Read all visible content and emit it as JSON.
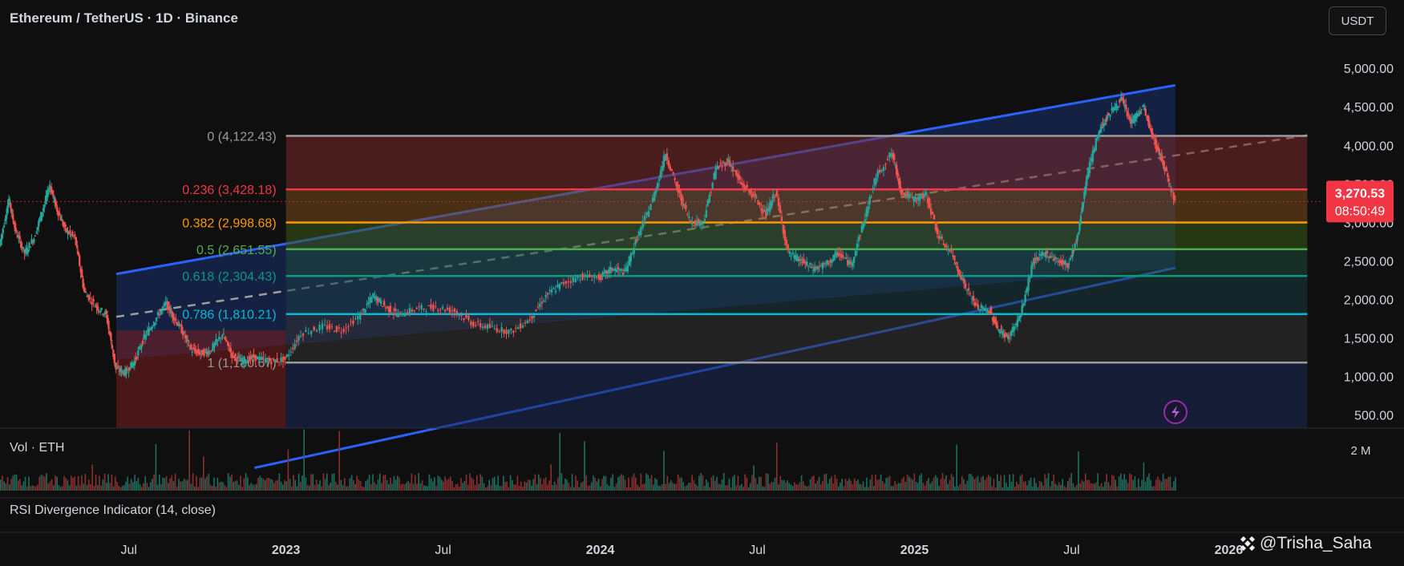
{
  "header": {
    "title": "Ethereum / TetherUS · 1D · Binance"
  },
  "currency_button": {
    "label": "USDT"
  },
  "price_badge": {
    "price": "3,270.53",
    "countdown": "08:50:49",
    "price_value": 3270.53
  },
  "volume_pane": {
    "label": "Vol · ETH",
    "axis_label": "2 M"
  },
  "rsi_pane": {
    "label": "RSI Divergence Indicator (14, close)"
  },
  "watermark": {
    "text": "@Trisha_Saha"
  },
  "colors": {
    "background": "#0f0f0f",
    "up": "#26a69a",
    "down": "#ef5350",
    "channel": "#2962ff",
    "price_badge": "#f23645"
  },
  "chart_data": {
    "type": "candlestick",
    "title": "Ethereum / TetherUS · 1D · Binance",
    "y_axis": {
      "ticks": [
        "5,000.00",
        "4,500.00",
        "4,000.00",
        "3,500.00",
        "3,000.00",
        "2,500.00",
        "2,000.00",
        "1,500.00",
        "1,000.00",
        "500.00"
      ],
      "ylim": [
        330,
        5470
      ]
    },
    "x_axis": {
      "ticks": [
        {
          "label": "Jul",
          "x": 2022.5
        },
        {
          "label": "2023",
          "x": 2023.0
        },
        {
          "label": "Jul",
          "x": 2023.5
        },
        {
          "label": "2024",
          "x": 2024.0
        },
        {
          "label": "Jul",
          "x": 2024.5
        },
        {
          "label": "2025",
          "x": 2025.0
        },
        {
          "label": "Jul",
          "x": 2025.5
        },
        {
          "label": "2026",
          "x": 2026.0
        }
      ],
      "xlim": [
        2022.09,
        2026.3
      ]
    },
    "price_path": [
      [
        2022.09,
        2700
      ],
      [
        2022.12,
        3300
      ],
      [
        2022.14,
        2900
      ],
      [
        2022.17,
        2600
      ],
      [
        2022.2,
        2800
      ],
      [
        2022.23,
        3200
      ],
      [
        2022.25,
        3480
      ],
      [
        2022.27,
        3200
      ],
      [
        2022.3,
        2900
      ],
      [
        2022.33,
        2800
      ],
      [
        2022.36,
        2100
      ],
      [
        2022.4,
        1900
      ],
      [
        2022.43,
        1800
      ],
      [
        2022.46,
        1100
      ],
      [
        2022.49,
        1050
      ],
      [
        2022.52,
        1200
      ],
      [
        2022.55,
        1500
      ],
      [
        2022.58,
        1700
      ],
      [
        2022.62,
        1950
      ],
      [
        2022.64,
        1800
      ],
      [
        2022.67,
        1600
      ],
      [
        2022.7,
        1350
      ],
      [
        2022.73,
        1300
      ],
      [
        2022.76,
        1330
      ],
      [
        2022.8,
        1550
      ],
      [
        2022.83,
        1280
      ],
      [
        2022.86,
        1200
      ],
      [
        2022.9,
        1250
      ],
      [
        2022.95,
        1200
      ],
      [
        2023.0,
        1220
      ],
      [
        2023.05,
        1560
      ],
      [
        2023.12,
        1650
      ],
      [
        2023.18,
        1600
      ],
      [
        2023.24,
        1800
      ],
      [
        2023.28,
        2050
      ],
      [
        2023.32,
        1900
      ],
      [
        2023.36,
        1800
      ],
      [
        2023.42,
        1880
      ],
      [
        2023.48,
        1900
      ],
      [
        2023.54,
        1850
      ],
      [
        2023.6,
        1680
      ],
      [
        2023.66,
        1630
      ],
      [
        2023.72,
        1580
      ],
      [
        2023.78,
        1750
      ],
      [
        2023.83,
        2050
      ],
      [
        2023.88,
        2200
      ],
      [
        2023.94,
        2300
      ],
      [
        2024.0,
        2280
      ],
      [
        2024.04,
        2400
      ],
      [
        2024.08,
        2350
      ],
      [
        2024.12,
        2800
      ],
      [
        2024.17,
        3300
      ],
      [
        2024.21,
        3900
      ],
      [
        2024.25,
        3400
      ],
      [
        2024.29,
        3000
      ],
      [
        2024.33,
        3000
      ],
      [
        2024.37,
        3700
      ],
      [
        2024.41,
        3800
      ],
      [
        2024.45,
        3500
      ],
      [
        2024.49,
        3350
      ],
      [
        2024.53,
        3100
      ],
      [
        2024.56,
        3400
      ],
      [
        2024.6,
        2600
      ],
      [
        2024.64,
        2500
      ],
      [
        2024.68,
        2400
      ],
      [
        2024.72,
        2450
      ],
      [
        2024.76,
        2600
      ],
      [
        2024.8,
        2450
      ],
      [
        2024.84,
        3000
      ],
      [
        2024.88,
        3600
      ],
      [
        2024.93,
        3900
      ],
      [
        2024.96,
        3400
      ],
      [
        2025.0,
        3300
      ],
      [
        2025.04,
        3350
      ],
      [
        2025.08,
        2800
      ],
      [
        2025.12,
        2600
      ],
      [
        2025.16,
        2200
      ],
      [
        2025.2,
        1900
      ],
      [
        2025.24,
        1850
      ],
      [
        2025.27,
        1600
      ],
      [
        2025.3,
        1500
      ],
      [
        2025.34,
        1800
      ],
      [
        2025.38,
        2500
      ],
      [
        2025.42,
        2600
      ],
      [
        2025.46,
        2500
      ],
      [
        2025.49,
        2450
      ],
      [
        2025.52,
        2800
      ],
      [
        2025.55,
        3600
      ],
      [
        2025.59,
        4200
      ],
      [
        2025.62,
        4400
      ],
      [
        2025.66,
        4600
      ],
      [
        2025.69,
        4300
      ],
      [
        2025.73,
        4500
      ],
      [
        2025.76,
        4100
      ],
      [
        2025.78,
        3900
      ],
      [
        2025.8,
        3700
      ],
      [
        2025.83,
        3270
      ]
    ],
    "fib_retracement": [
      {
        "level": "0",
        "label": "0 (4,122.43)",
        "price": 4122.43,
        "color": "#9a9a9a"
      },
      {
        "level": "0.236",
        "label": "0.236 (3,428.18)",
        "price": 3428.18,
        "color": "#f23645"
      },
      {
        "level": "0.382",
        "label": "0.382 (2,998.68)",
        "price": 2998.68,
        "color": "#ff9800"
      },
      {
        "level": "0.5",
        "label": "0.5 (2,651.55)",
        "price": 2651.55,
        "color": "#4caf50"
      },
      {
        "level": "0.618",
        "label": "0.618 (2,304.43)",
        "price": 2304.43,
        "color": "#089981"
      },
      {
        "level": "0.786",
        "label": "0.786 (1,810.21)",
        "price": 1810.21,
        "color": "#00bcd4"
      },
      {
        "level": "1",
        "label": "1 (1,180.67)",
        "price": 1180.67,
        "color": "#9a9a9a"
      }
    ],
    "fib_zones": [
      {
        "from": 4122.43,
        "to": 3428.18,
        "color": "#7a2a2a"
      },
      {
        "from": 3428.18,
        "to": 2998.68,
        "color": "#7a4a1a"
      },
      {
        "from": 2998.68,
        "to": 2651.55,
        "color": "#3a5a1a"
      },
      {
        "from": 2651.55,
        "to": 2304.43,
        "color": "#1d4a3a"
      },
      {
        "from": 2304.43,
        "to": 1810.21,
        "color": "#1b3a44"
      },
      {
        "from": 1810.21,
        "to": 1180.67,
        "color": "#333333"
      }
    ],
    "fib_extent": [
      2023.0,
      2026.25
    ],
    "parallel_channel": {
      "start_date": 2022.46,
      "end_date": 2025.83,
      "upper": [
        2330,
        4780
      ],
      "lower": [
        1220,
        2410
      ],
      "extended_mid_end": [
        2026.25,
        4130
      ]
    },
    "volume": {
      "peak_label": "2 M"
    },
    "legend": "none"
  }
}
